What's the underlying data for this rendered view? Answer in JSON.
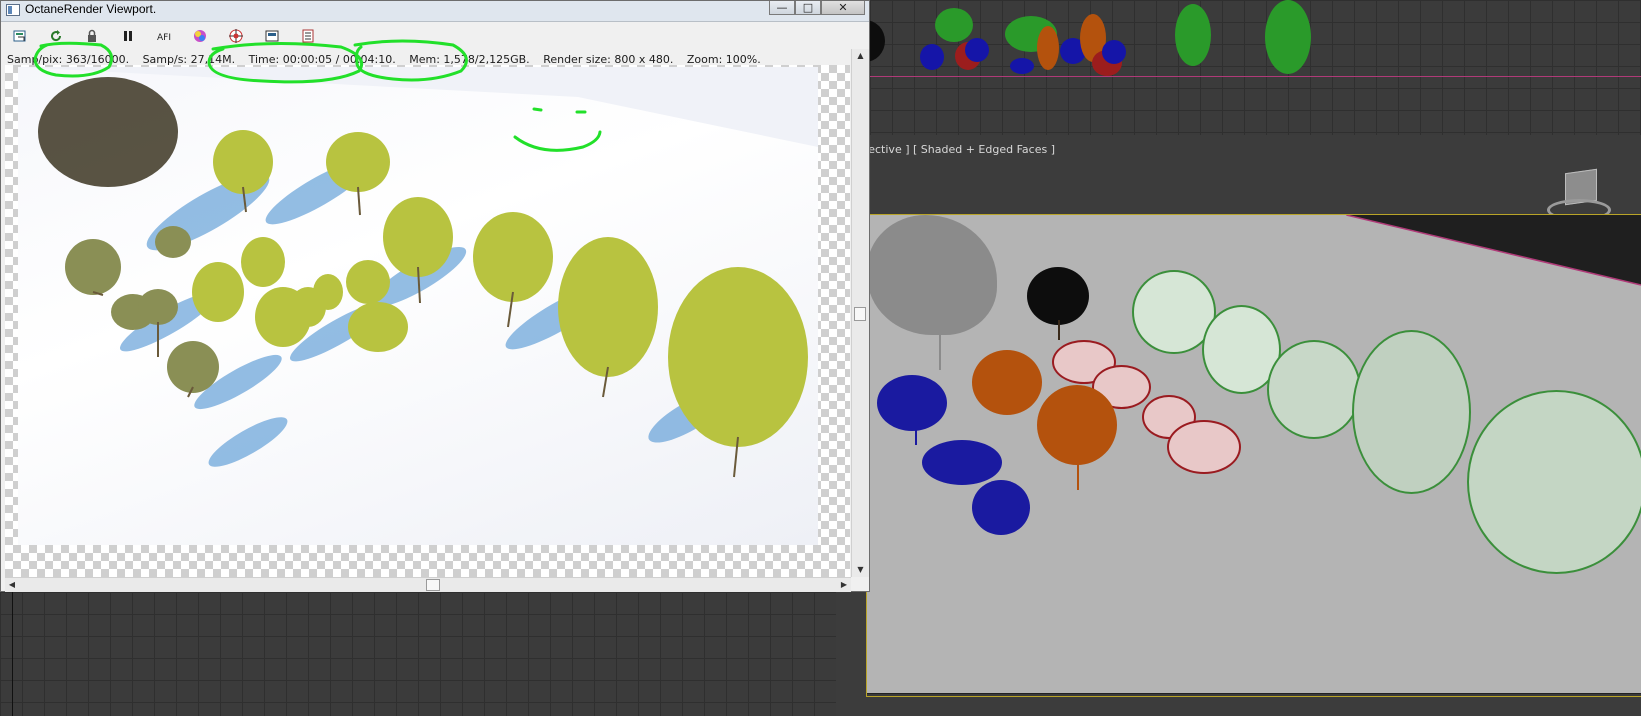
{
  "octane_window": {
    "title": "OctaneRender Viewport.",
    "window_buttons": {
      "minimize": "—",
      "maximize": "□",
      "close": "✕"
    },
    "toolbar": [
      {
        "icon": "save-image-icon"
      },
      {
        "icon": "restart-render-icon"
      },
      {
        "icon": "lock-icon"
      },
      {
        "icon": "pause-icon"
      },
      {
        "icon": "afi-icon",
        "label": "AFI"
      },
      {
        "icon": "color-picker-icon"
      },
      {
        "icon": "focus-target-icon"
      },
      {
        "icon": "region-render-icon"
      },
      {
        "icon": "settings-panel-icon"
      }
    ],
    "status": {
      "samples": "Samp/pix: 363/16000.",
      "samples_per_sec": "Samp/s: 27,14M.",
      "time": "Time: 00:00:05 / 00:04:10.",
      "memory": "Mem: 1,578/2,125GB.",
      "render_size": "Render size: 800 x 480.",
      "zoom": "Zoom: 100%."
    },
    "annotation_color": "#22e02a"
  },
  "perspective_viewport": {
    "label_left": "Perspective ]",
    "label_mode": "[ Shaded + Edged Faces ]",
    "frame_color": "#b9a428",
    "tree_colors": {
      "gray": "#8d8d8d",
      "black": "#0d0d0d",
      "blue": "#1a1aa0",
      "orange": "#b4520d",
      "red": "#9a1b20",
      "green": "#3b8f3b"
    }
  },
  "top_viewport": {
    "border_line_color": "#b03a78"
  }
}
